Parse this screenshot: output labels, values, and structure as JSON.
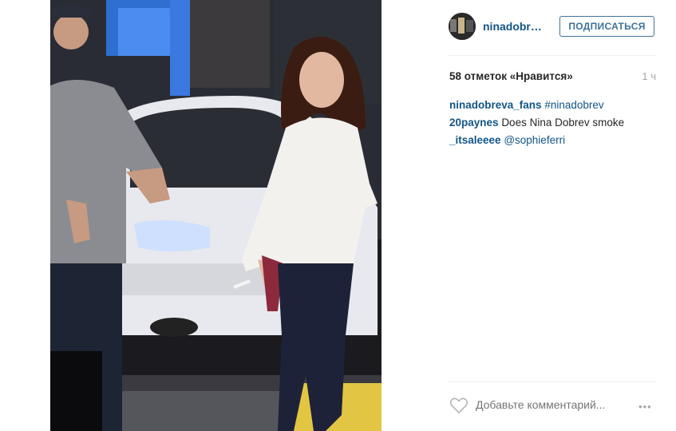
{
  "post": {
    "username": "ninadobre…",
    "follow_label": "ПОДПИСАТЬСЯ",
    "likes_text": "58 отметок «Нравится»",
    "time_ago": "1 ч",
    "comments": [
      {
        "author": "ninadobreva_fans",
        "text": "#ninadobrev"
      },
      {
        "author": "20paynes",
        "text": "Does Nina Dobrev smoke"
      },
      {
        "author": "_itsaleeee",
        "text": "@sophieferri"
      }
    ],
    "comment_placeholder": "Добавьте комментарий...",
    "more_label": "•••"
  },
  "icons": {
    "like": "heart-outline-icon",
    "more": "more-options-icon"
  },
  "colors": {
    "link": "#125688",
    "follow_border": "#3f729b",
    "muted": "#a5a7aa",
    "text": "#262626"
  }
}
